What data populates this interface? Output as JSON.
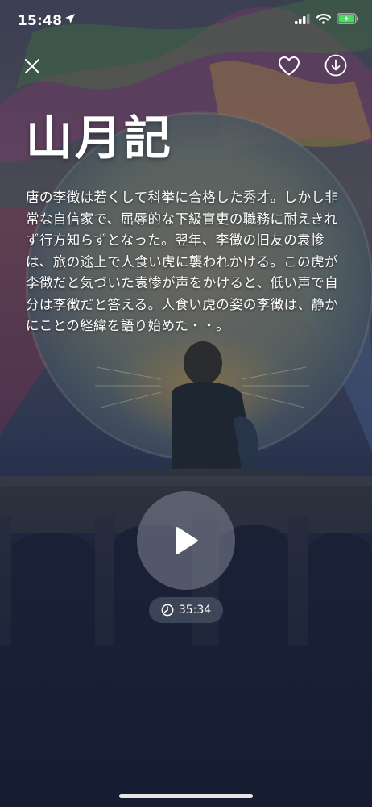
{
  "status_bar": {
    "time": "15:48",
    "location_icon": "location-arrow-icon",
    "signal_icon": "cellular-signal-icon",
    "wifi_icon": "wifi-icon",
    "battery_icon": "battery-charging-icon",
    "battery_color": "#4cd964"
  },
  "header": {
    "close_icon": "close-icon",
    "favorite_icon": "heart-icon",
    "download_icon": "download-icon"
  },
  "content": {
    "title": "山月記",
    "description": "唐の李徴は若くして科挙に合格した秀才。しかし非常な自信家で、屈辱的な下級官吏の職務に耐えきれず行方知らずとなった。翌年、李徴の旧友の袁惨は、旅の途上で人食い虎に襲われかける。この虎が李徴だと気づいた袁惨が声をかけると、低い声で自分は李徴だと答える。人食い虎の姿の李徴は、静かにことの経緯を語り始めた・・。"
  },
  "player": {
    "play_icon": "play-icon",
    "duration_icon": "clock-icon",
    "duration": "35:34"
  }
}
